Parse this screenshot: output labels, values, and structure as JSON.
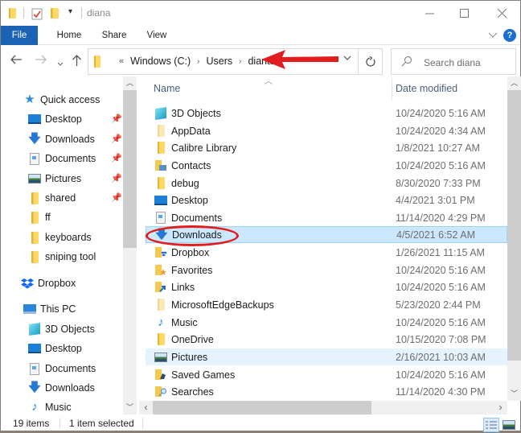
{
  "window": {
    "title": "diana",
    "minimize_icon": "minimize-icon",
    "maximize_icon": "maximize-icon",
    "close_icon": "close-icon"
  },
  "ribbon": {
    "tabs": [
      {
        "label": "File"
      },
      {
        "label": "Home"
      },
      {
        "label": "Share"
      },
      {
        "label": "View"
      }
    ],
    "help_label": "?"
  },
  "navbar": {
    "breadcrumb_overflow": "«",
    "breadcrumbs": [
      "Windows (C:)",
      "Users",
      "diana"
    ],
    "search_placeholder": "Search diana"
  },
  "nav_pane": {
    "items": [
      {
        "label": "Quick access",
        "icon": "star-icon",
        "pinned": false,
        "level": 0
      },
      {
        "label": "Desktop",
        "icon": "desktop-icon",
        "pinned": true,
        "level": 1
      },
      {
        "label": "Downloads",
        "icon": "downloads-icon",
        "pinned": true,
        "level": 1
      },
      {
        "label": "Documents",
        "icon": "documents-icon",
        "pinned": true,
        "level": 1
      },
      {
        "label": "Pictures",
        "icon": "pictures-icon",
        "pinned": true,
        "level": 1
      },
      {
        "label": "shared",
        "icon": "folder-icon",
        "pinned": true,
        "level": 1
      },
      {
        "label": "ff",
        "icon": "folder-icon",
        "pinned": false,
        "level": 1
      },
      {
        "label": "keyboards",
        "icon": "folder-icon",
        "pinned": false,
        "level": 1
      },
      {
        "label": "sniping tool",
        "icon": "folder-icon",
        "pinned": false,
        "level": 1
      },
      {
        "label": "Dropbox",
        "icon": "dropbox-icon",
        "pinned": false,
        "level": 0
      },
      {
        "label": "This PC",
        "icon": "this-pc-icon",
        "pinned": false,
        "level": 0
      },
      {
        "label": "3D Objects",
        "icon": "3d-objects-icon",
        "pinned": false,
        "level": 1
      },
      {
        "label": "Desktop",
        "icon": "desktop-icon",
        "pinned": false,
        "level": 1
      },
      {
        "label": "Documents",
        "icon": "documents-icon",
        "pinned": false,
        "level": 1
      },
      {
        "label": "Downloads",
        "icon": "downloads-icon",
        "pinned": false,
        "level": 1
      },
      {
        "label": "Music",
        "icon": "music-icon",
        "pinned": false,
        "level": 1
      }
    ]
  },
  "file_list": {
    "columns": [
      "Name",
      "Date modified"
    ],
    "rows": [
      {
        "name": "3D Objects",
        "date": "10/24/2020 5:16 AM",
        "icon": "3d-objects-icon"
      },
      {
        "name": "AppData",
        "date": "10/24/2020 4:34 AM",
        "icon": "folder-hidden-icon"
      },
      {
        "name": "Calibre Library",
        "date": "1/8/2021 10:27 AM",
        "icon": "folder-icon"
      },
      {
        "name": "Contacts",
        "date": "10/24/2020 5:16 AM",
        "icon": "contacts-folder-icon"
      },
      {
        "name": "debug",
        "date": "8/30/2020 7:33 PM",
        "icon": "folder-icon"
      },
      {
        "name": "Desktop",
        "date": "4/4/2021 3:01 PM",
        "icon": "desktop-icon"
      },
      {
        "name": "Documents",
        "date": "11/14/2020 4:29 PM",
        "icon": "documents-icon"
      },
      {
        "name": "Downloads",
        "date": "4/5/2021 6:52 AM",
        "icon": "downloads-icon",
        "state": "selected"
      },
      {
        "name": "Dropbox",
        "date": "1/26/2021 11:15 AM",
        "icon": "dropbox-folder-icon"
      },
      {
        "name": "Favorites",
        "date": "10/24/2020 5:16 AM",
        "icon": "favorites-folder-icon"
      },
      {
        "name": "Links",
        "date": "10/24/2020 5:16 AM",
        "icon": "links-folder-icon"
      },
      {
        "name": "MicrosoftEdgeBackups",
        "date": "5/23/2020 2:44 PM",
        "icon": "folder-hidden-icon"
      },
      {
        "name": "Music",
        "date": "10/24/2020 5:16 AM",
        "icon": "music-icon"
      },
      {
        "name": "OneDrive",
        "date": "10/15/2020 7:08 PM",
        "icon": "folder-icon"
      },
      {
        "name": "Pictures",
        "date": "2/16/2021 10:03 AM",
        "icon": "pictures-icon",
        "state": "hover"
      },
      {
        "name": "Saved Games",
        "date": "10/24/2020 5:16 AM",
        "icon": "saved-games-folder-icon"
      },
      {
        "name": "Searches",
        "date": "11/14/2020 4:30 PM",
        "icon": "searches-folder-icon"
      }
    ]
  },
  "status_bar": {
    "item_count": "19 items",
    "selection": "1 item selected"
  },
  "annotations": {
    "arrow_color": "#e21d1d",
    "circle_color": "#e21d1d"
  },
  "colors": {
    "accent": "#1a63b5",
    "selection_bg": "#cce8ff",
    "hover_bg": "#e5f3ff"
  }
}
